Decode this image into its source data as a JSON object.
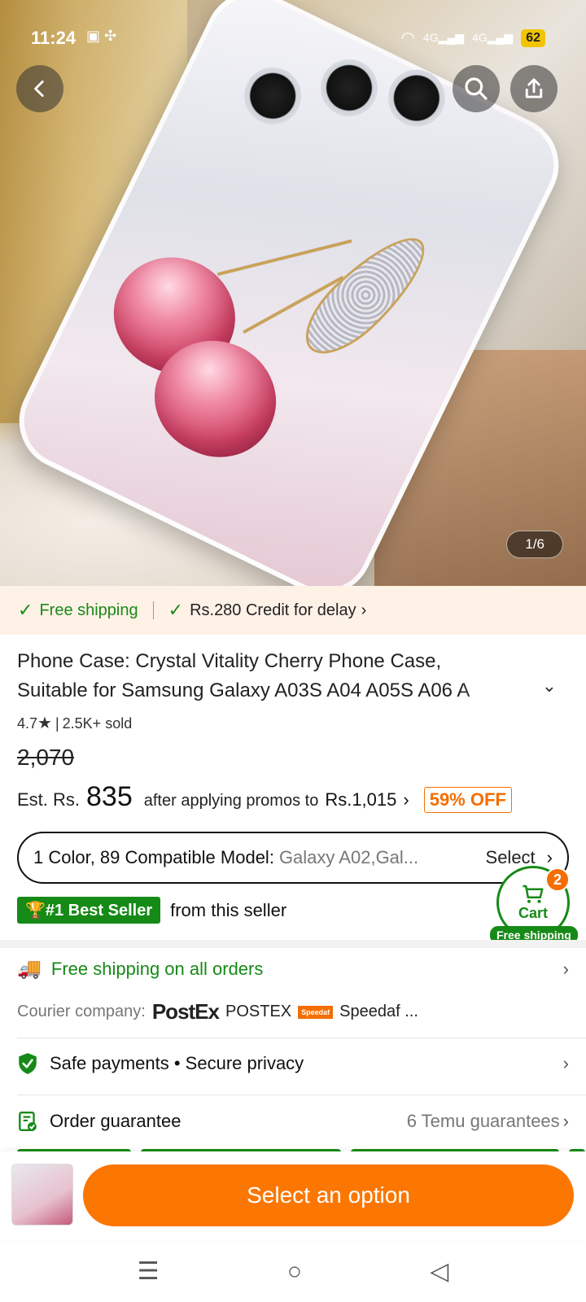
{
  "status_bar": {
    "time": "11:24",
    "network_1": "4G",
    "network_2": "4G",
    "battery": "62"
  },
  "hero": {
    "image_counter": "1/6"
  },
  "shipping_banner": {
    "free_shipping": "Free shipping",
    "credit": "Rs.280 Credit for delay"
  },
  "product": {
    "title_line1": "Phone Case: Crystal Vitality Cherry Phone Case,",
    "title_line2": "Suitable for Samsung Galaxy A03S A04 A05S A06 A",
    "rating": "4.7",
    "sold": "2.5K+ sold",
    "original_price": "2,070",
    "est_label": "Est. Rs.",
    "est_price": "835",
    "promo_text": "after applying promos to",
    "promo_price": "Rs.1,015",
    "discount": "59% OFF"
  },
  "variant": {
    "label": "1 Color, 89 Compatible Model:",
    "value": "Galaxy A02,Gal...",
    "select": "Select"
  },
  "bestseller": {
    "badge": "#1 Best Seller",
    "text": "from this seller"
  },
  "cart": {
    "label": "Cart",
    "count": "2",
    "free_shipping": "Free shipping"
  },
  "shipping_row": {
    "title": "Free shipping on all orders",
    "courier_label": "Courier company:",
    "courier_logo": "PostEx",
    "courier_1": "POSTEX",
    "courier_2_logo": "Speedaf",
    "courier_2": "Speedaf ..."
  },
  "safe_payments": {
    "text": "Safe payments • Secure privacy"
  },
  "order_guarantee": {
    "text": "Order guarantee",
    "detail": "6 Temu guarantees"
  },
  "bottom": {
    "cta": "Select an option"
  },
  "colors": {
    "accent": "#fb7701",
    "green": "#168a16"
  }
}
